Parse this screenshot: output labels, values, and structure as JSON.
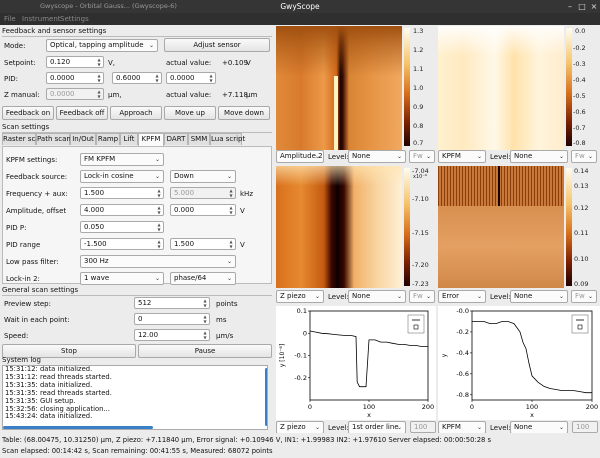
{
  "window": {
    "title": "GwyScope",
    "faded_title": "Gwyscope - Orbital Gauss... (Gwyscope-6)"
  },
  "menubar": {
    "items": [
      "File",
      "Instrument",
      "Settings"
    ]
  },
  "feedback": {
    "group_title": "Feedback and sensor settings",
    "mode_label": "Mode:",
    "mode_value": "Optical, tapping amplitude",
    "adjust_button": "Adjust sensor",
    "setpoint_label": "Setpoint:",
    "setpoint_value": "0.120",
    "setpoint_unit": "V,",
    "actual_label1": "actual value:",
    "actual_value1": "+0.109",
    "actual_unit1": "V",
    "pid_label": "PID:",
    "pid_p": "0.0000",
    "pid_i": "0.6000",
    "pid_d": "0.0000",
    "zmanual_label": "Z manual:",
    "zmanual_value": "0.0000",
    "zmanual_unit": "μm,",
    "actual_label2": "actual value:",
    "actual_value2": "+7.118",
    "actual_unit2": "μm",
    "buttons": [
      "Feedback on",
      "Feedback off",
      "Approach",
      "Move up",
      "Move down"
    ]
  },
  "scan": {
    "group_title": "Scan settings",
    "tabs": [
      "Raster scan",
      "Path scan",
      "In/Out",
      "Ramp",
      "Lift",
      "KPFM",
      "DART",
      "SMM",
      "Lua script"
    ],
    "active_tab": "KPFM",
    "kpfm_settings_label": "KPFM settings:",
    "kpfm_settings_value": "FM KPFM",
    "feedback_source_label": "Feedback source:",
    "feedback_source_value": "Lock-in cosine",
    "feedback_dir_value": "Down",
    "freq_label": "Frequency + aux:",
    "freq_value": "1.500",
    "freq_aux": "5.000",
    "freq_unit": "kHz",
    "amp_label": "Amplitude, offset",
    "amp_value": "4.000",
    "amp_offset": "0.000",
    "amp_unit": "V",
    "pidp_label": "PID P:",
    "pidp_value": "0.050",
    "pidrange_label": "PID range",
    "pidrange_min": "-1.500",
    "pidrange_max": "1.500",
    "pidrange_unit": "V",
    "lowpass_label": "Low pass filter:",
    "lowpass_value": "300 Hz",
    "lockin_label": "Lock-in 2:",
    "lockin_value": "1 wave",
    "lockin_phase": "phase/64"
  },
  "general": {
    "group_title": "General scan settings",
    "preview_label": "Preview step:",
    "preview_value": "512",
    "preview_unit": "points",
    "wait_label": "Wait in each point:",
    "wait_value": "0",
    "wait_unit": "ms",
    "speed_label": "Speed:",
    "speed_value": "12.00",
    "speed_unit": "μm/s",
    "stop_button": "Stop",
    "pause_button": "Pause"
  },
  "syslog": {
    "title": "System log",
    "lines": [
      "15:31:12: data initialized.",
      "15:31:12: read threads started.",
      "15:31:35: data initialized.",
      "15:31:35: read threads started.",
      "15:31:35: GUI setup.",
      "15:32:56: closing application...",
      "15:43:24: data initialized."
    ]
  },
  "status": {
    "line1": "Table: (68.00475, 10.31250) μm, Z piezo: +7.11840 μm, Error signal: +0.10946 V, IN1: +1.99983 IN2: +1.97610  Server elapsed: 00:00:50:28 s",
    "line2": "Scan elapsed: 00:14:42 s,  Scan remaining: 00:41:55 s,  Measured:  68072 points"
  },
  "panels": {
    "p1": {
      "channel": "Amplitude 2",
      "level_label": "Level:",
      "level_value": "None",
      "fw": "Fw",
      "ticks": [
        "1.3",
        "1.2",
        "1.1",
        "1.0",
        "0.9",
        "0.8",
        "0.7"
      ]
    },
    "p2": {
      "channel": "KPFM",
      "level_label": "Level:",
      "level_value": "None",
      "fw": "Fw",
      "ticks": [
        "0.0",
        "-0.2",
        "-0.3",
        "-0.4",
        "-0.5",
        "-0.6",
        "-0.7",
        "-0.8"
      ]
    },
    "p3": {
      "channel": "Z piezo",
      "level_label": "Level:",
      "level_value": "None",
      "fw": "Fw",
      "exponent": "x10⁻⁶",
      "ticks": [
        "-7.04",
        "-7.10",
        "-7.15",
        "-7.20",
        "-7.23"
      ]
    },
    "p4": {
      "channel": "Error",
      "level_label": "Level:",
      "level_value": "None",
      "fw": "Fw",
      "ticks": [
        "0.14",
        "0.13",
        "0.12",
        "0.11",
        "0.10",
        "0.09"
      ]
    },
    "p5": {
      "channel": "Z piezo",
      "level_label": "Level:",
      "level_value": "1st order line",
      "count": "100"
    },
    "p6": {
      "channel": "KPFM",
      "level_label": "Level:",
      "level_value": "None",
      "count": "100"
    }
  },
  "chart_data": [
    {
      "type": "line",
      "xlabel": "x",
      "ylabel": "y [10⁻⁶]",
      "xlim": [
        0,
        200
      ],
      "ylim": [
        -0.3,
        0.1
      ],
      "xticks": [
        "0",
        "100",
        "200"
      ],
      "yticks": [
        "0.1",
        "0",
        "-0.1",
        "-0.2"
      ],
      "legend": "top-right",
      "x": [
        0,
        10,
        20,
        30,
        40,
        50,
        60,
        70,
        78,
        80,
        84,
        90,
        95,
        100,
        110,
        120,
        130,
        140,
        150,
        160,
        170,
        180,
        190,
        200
      ],
      "series": [
        {
          "values": [
            0.01,
            0.005,
            0.0,
            -0.002,
            -0.005,
            -0.008,
            -0.01,
            -0.01,
            -0.015,
            -0.22,
            -0.24,
            -0.24,
            -0.24,
            -0.03,
            -0.03,
            -0.04,
            -0.04,
            -0.045,
            -0.05,
            -0.05,
            -0.055,
            -0.055,
            -0.06,
            -0.06
          ]
        }
      ]
    },
    {
      "type": "line",
      "xlabel": "x",
      "ylabel": "y",
      "xlim": [
        0,
        200
      ],
      "ylim": [
        -0.85,
        0.0
      ],
      "xticks": [
        "0",
        "100",
        "200"
      ],
      "yticks": [
        "-0.0",
        "-0.2",
        "-0.4",
        "-0.6",
        "-0.8"
      ],
      "legend": "top-right",
      "x": [
        0,
        10,
        20,
        30,
        40,
        50,
        60,
        70,
        80,
        85,
        90,
        95,
        100,
        110,
        120,
        130,
        140,
        150,
        160,
        170,
        180,
        190,
        200
      ],
      "series": [
        {
          "values": [
            -0.1,
            -0.1,
            -0.1,
            -0.12,
            -0.12,
            -0.1,
            -0.1,
            -0.12,
            -0.2,
            -0.3,
            -0.36,
            -0.5,
            -0.62,
            -0.68,
            -0.72,
            -0.74,
            -0.75,
            -0.76,
            -0.76,
            -0.76,
            -0.77,
            -0.78,
            -0.78
          ]
        }
      ]
    }
  ],
  "colors": {
    "hot_top": "#ffffff",
    "hot_mid": "#e88830",
    "hot_dark": "#3a0800",
    "ui_bg": "#ececec",
    "titlebar": "#353535"
  },
  "icons": {
    "titlebar_min": "minimize-icon",
    "titlebar_max": "maximize-icon",
    "titlebar_close": "close-icon"
  }
}
